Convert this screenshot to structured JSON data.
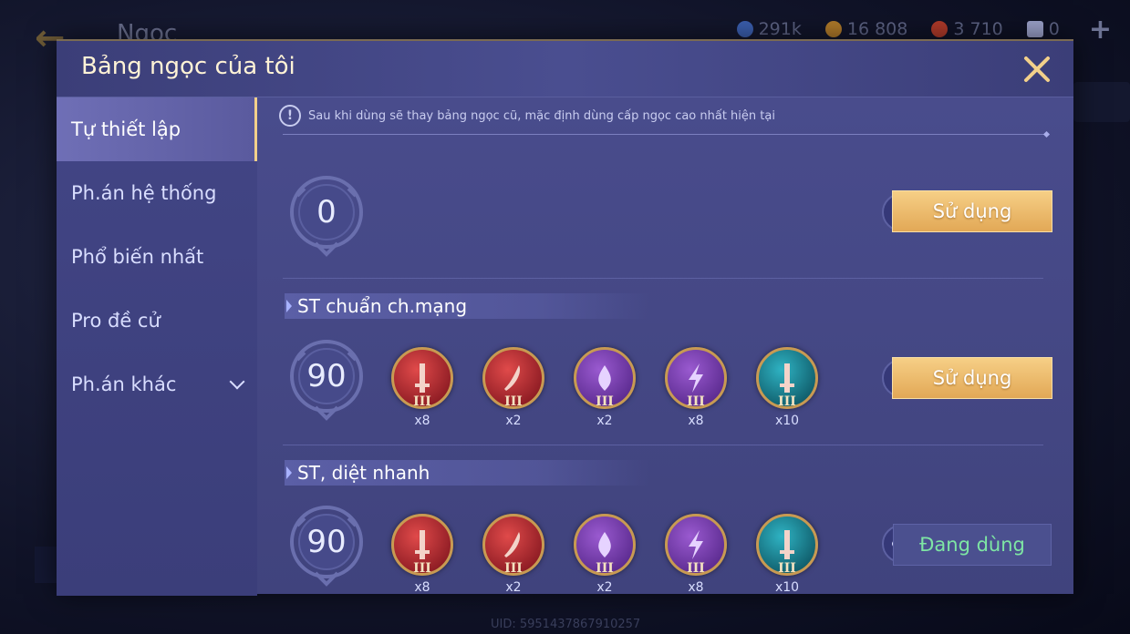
{
  "background": {
    "title": "Ngọc",
    "currencies": [
      {
        "value": "291k",
        "color": "#3b5fb0"
      },
      {
        "value": "16 808",
        "color": "#b07a2a"
      },
      {
        "value": "3 710",
        "color": "#b03a2a"
      },
      {
        "value": "0",
        "color": "#9aa0c8"
      }
    ],
    "uid": "UID: 5951437867910257"
  },
  "modal": {
    "title": "Bảng ngọc của tôi"
  },
  "sidebar": {
    "items": [
      {
        "label": "Tự thiết lập"
      },
      {
        "label": "Ph.án hệ thống"
      },
      {
        "label": "Phổ biến nhất"
      },
      {
        "label": "Pro đề cử"
      },
      {
        "label": "Ph.án khác"
      }
    ]
  },
  "notice": {
    "text": "Sau khi dùng sẽ thay bảng ngọc cũ, mặc định dùng cấp ngọc cao nhất hiện tại"
  },
  "sets": [
    {
      "name": "",
      "level": "0",
      "button": "Sử dụng",
      "gems": []
    },
    {
      "name": "ST chuẩn ch.mạng",
      "level": "90",
      "button": "Sử dụng",
      "gems": [
        {
          "tier": "III",
          "count": "x8",
          "color": "red",
          "icon": "sword-icon"
        },
        {
          "tier": "III",
          "count": "x2",
          "color": "red",
          "icon": "blade-icon"
        },
        {
          "tier": "III",
          "count": "x2",
          "color": "purple",
          "icon": "drop-icon"
        },
        {
          "tier": "III",
          "count": "x8",
          "color": "purple",
          "icon": "lightning-icon"
        },
        {
          "tier": "III",
          "count": "x10",
          "color": "teal",
          "icon": "sword-icon"
        }
      ]
    },
    {
      "name": "ST, diệt nhanh",
      "level": "90",
      "button": "Đang dùng",
      "gems": [
        {
          "tier": "III",
          "count": "x8",
          "color": "red",
          "icon": "sword-icon"
        },
        {
          "tier": "III",
          "count": "x2",
          "color": "red",
          "icon": "blade-icon"
        },
        {
          "tier": "III",
          "count": "x2",
          "color": "purple",
          "icon": "drop-icon"
        },
        {
          "tier": "III",
          "count": "x8",
          "color": "purple",
          "icon": "lightning-icon"
        },
        {
          "tier": "III",
          "count": "x10",
          "color": "teal",
          "icon": "sword-icon"
        }
      ]
    }
  ],
  "colors": {
    "gem_red": "#b8232a",
    "gem_purple": "#7a3fb0",
    "gem_teal": "#1c8a9a",
    "accent_gold": "#f2d08a",
    "in_use_green": "#7ee6a4"
  }
}
